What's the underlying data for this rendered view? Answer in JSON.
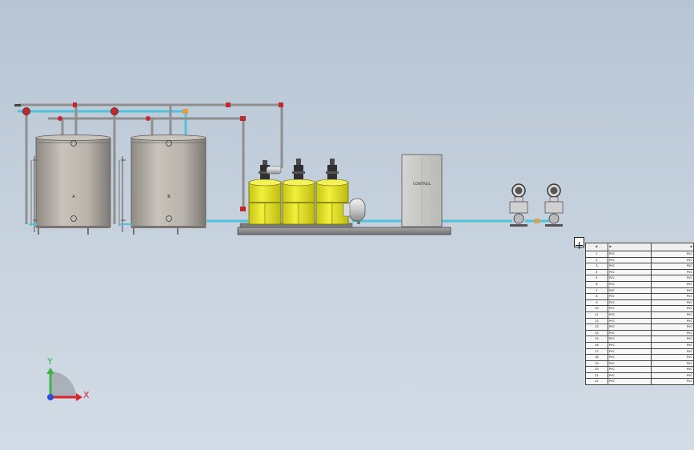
{
  "tank_labels": [
    "A",
    "B"
  ],
  "control_cabinet_label": "CONTROL",
  "axis": {
    "x_label": "X",
    "y_label": "Y"
  },
  "bom_table": {
    "headers": [
      "#",
      "#",
      "#"
    ],
    "rows": [
      [
        "1",
        "PVC",
        "PVC"
      ],
      [
        "2",
        "PVC",
        "PVC"
      ],
      [
        "3",
        "PVC",
        "PVC"
      ],
      [
        "4",
        "PVC",
        "PVC"
      ],
      [
        "5",
        "PVC",
        "PVC"
      ],
      [
        "6",
        "PVC",
        "PVC"
      ],
      [
        "7",
        "PVC",
        "PVC"
      ],
      [
        "8",
        "PVC",
        "PVC"
      ],
      [
        "9",
        "PVC",
        "PVC"
      ],
      [
        "10",
        "PVC",
        "PVC"
      ],
      [
        "11",
        "PVC",
        "PVC"
      ],
      [
        "12",
        "PVC",
        "PVC"
      ],
      [
        "13",
        "PVC",
        "PVC"
      ],
      [
        "14",
        "PVC",
        "PVC"
      ],
      [
        "15",
        "PVC",
        "PVC"
      ],
      [
        "16",
        "PVC",
        "PVC"
      ],
      [
        "17",
        "PVC",
        "PVC"
      ],
      [
        "18",
        "PVC",
        "PVC"
      ],
      [
        "19",
        "PVC",
        "PVC"
      ],
      [
        "20",
        "PVC",
        "PVC"
      ],
      [
        "21",
        "PVC",
        "PVC"
      ],
      [
        "22",
        "PVC",
        "PVC"
      ]
    ]
  },
  "colors": {
    "pipe_blue": "#4fc3d9",
    "pipe_grey": "#9a9a9a",
    "valve_red": "#c0282d",
    "tank_grey": "#b3aea6",
    "dosing_yellow": "#e7e52a",
    "axis_x": "#d9262a",
    "axis_y": "#3fb34a",
    "axis_z": "#2b4fd1"
  }
}
